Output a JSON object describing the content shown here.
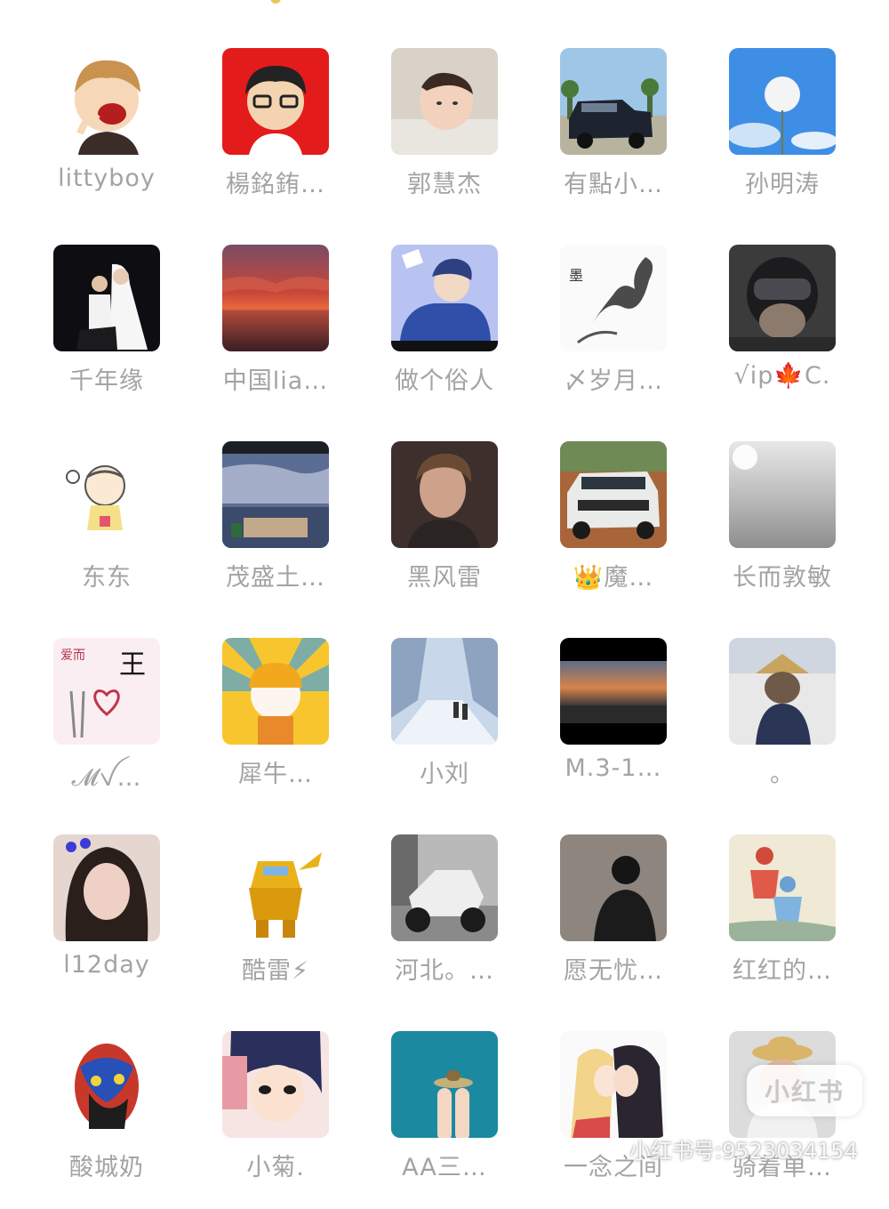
{
  "members": [
    {
      "name": "littyboy",
      "avatar": "cartoon-boy-laughing"
    },
    {
      "name": "楊銘銪…",
      "avatar": "cartoon-man-glasses-red"
    },
    {
      "name": "郭慧杰",
      "avatar": "baby-photo"
    },
    {
      "name": "有點小…",
      "avatar": "black-suv-photo"
    },
    {
      "name": "孙明涛",
      "avatar": "dandelion-sky"
    },
    {
      "name": "千年缘",
      "avatar": "wedding-couple"
    },
    {
      "name": "中国lia…",
      "avatar": "red-sunset-clouds"
    },
    {
      "name": "做个俗人",
      "avatar": "anime-boy-blue"
    },
    {
      "name": "〆岁月…",
      "avatar": "ink-dragon"
    },
    {
      "name": "√ip🍁C.",
      "avatar": "cat-helmet"
    },
    {
      "name": "东东",
      "avatar": "cartoon-old-man"
    },
    {
      "name": "茂盛土…",
      "avatar": "courtyard-sky"
    },
    {
      "name": "黑风雷",
      "avatar": "young-man-portrait"
    },
    {
      "name": "👑魔…",
      "avatar": "white-land-rover"
    },
    {
      "name": "长而敦敏",
      "avatar": "grey-sky"
    },
    {
      "name": "𝓜ꪜ…",
      "avatar": "love-wang-card"
    },
    {
      "name": "犀牛…",
      "avatar": "cartoon-worker-sun"
    },
    {
      "name": "小刘",
      "avatar": "snowy-road"
    },
    {
      "name": "M.3-1…",
      "avatar": "dusk-horizon"
    },
    {
      "name": "。",
      "avatar": "monkey-hat"
    },
    {
      "name": "l12day",
      "avatar": "girl-portrait"
    },
    {
      "name": "酷雷⚡",
      "avatar": "gold-robot-toy"
    },
    {
      "name": "河北。…",
      "avatar": "motorcycle-street"
    },
    {
      "name": "愿无忧…",
      "avatar": "man-back-silhouette"
    },
    {
      "name": "红红的…",
      "avatar": "chinese-painting"
    },
    {
      "name": "酸城奶",
      "avatar": "colorful-face-art"
    },
    {
      "name": "小菊.",
      "avatar": "anime-girl-angry"
    },
    {
      "name": "AA三…",
      "avatar": "finger-faces-teal"
    },
    {
      "name": "一念之间",
      "avatar": "anime-couple-kiss"
    },
    {
      "name": "骑着单…",
      "avatar": "cat-straw-hat"
    }
  ],
  "watermark": {
    "logo_text": "小红书",
    "account_id": "小红书号:9523034154"
  }
}
